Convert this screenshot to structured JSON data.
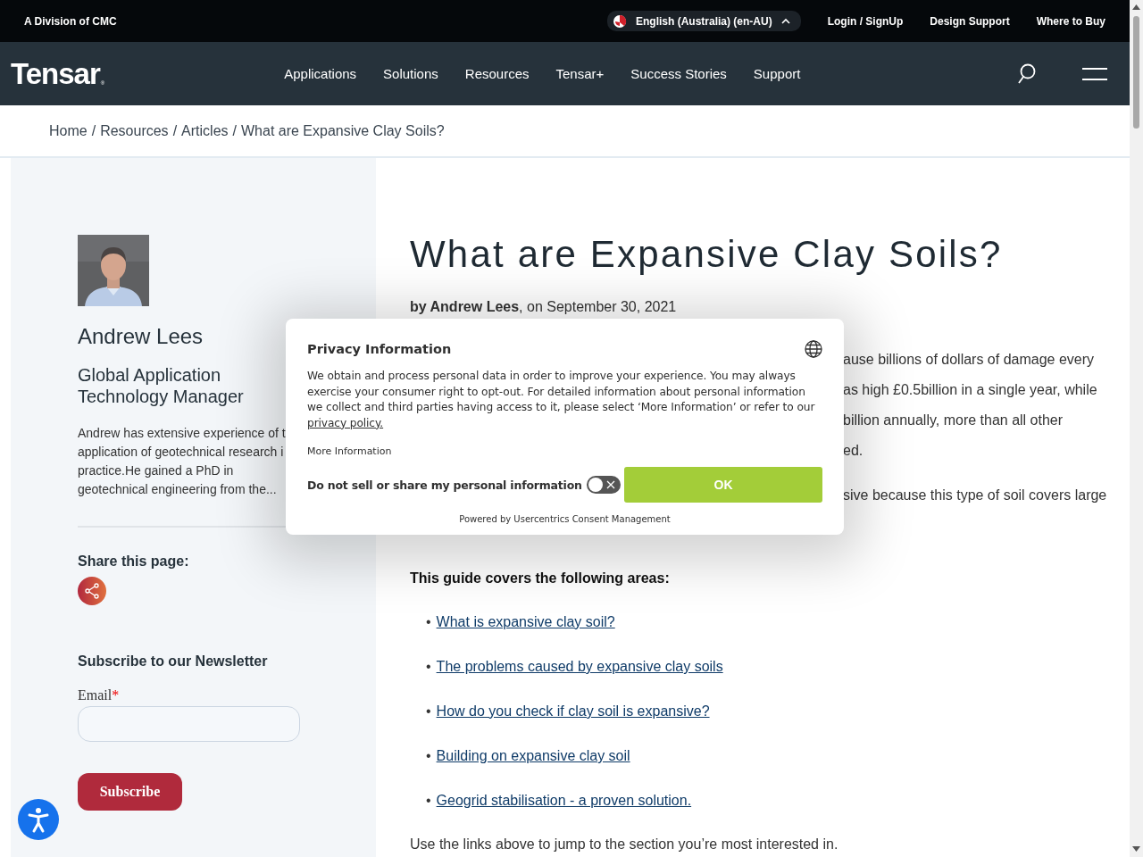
{
  "top_bar": {
    "division": "A Division of CMC",
    "language": "English (Australia) (en-AU)",
    "links": [
      "Login / SignUp",
      "Design Support",
      "Where to Buy"
    ]
  },
  "nav": {
    "logo": "Tensar",
    "logo_mark": "®",
    "items": [
      "Applications",
      "Solutions",
      "Resources",
      "Tensar+",
      "Success Stories",
      "Support"
    ]
  },
  "breadcrumb": {
    "items": [
      "Home",
      "Resources",
      "Articles",
      "What are Expansive Clay Soils?"
    ],
    "separators": [
      "/",
      "/",
      "/"
    ]
  },
  "author": {
    "photo": {
      "kind": "picture"
    },
    "name": "Andrew Lees",
    "role": "Global Application Technology Manager",
    "bio_lines": [
      "Andrew has extensive experience of t",
      "application of geotechnical research i",
      "practice.He gained a PhD in",
      "geotechnical engineering from the..."
    ],
    "share_heading": "Share this page:"
  },
  "newsletter": {
    "heading": "Subscribe to our Newsletter",
    "email_label": "Email",
    "required_mark": "*",
    "button": "Subscribe"
  },
  "article": {
    "title": "What are Expansive Clay Soils?",
    "byline": "**by Andrew Lees**, on September 30, 2021",
    "intro_fragments": [
      "ause billions of dollars of damage every",
      "as high £0.5billion in a single year, while",
      "billion annually, more than all other",
      "ed."
    ],
    "second_fragments": [
      "sive because this type of soil covers large"
    ],
    "guide_heading": "This guide covers the following areas:",
    "guide_links": [
      {
        "bullet": "•",
        "text": "What is expansive clay soil?"
      },
      {
        "bullet": "•",
        "text": "The problems caused by expansive clay soils"
      },
      {
        "bullet": "•",
        "text": "How do you check if clay soil is expansive?"
      },
      {
        "bullet": "•",
        "text": "Building on expansive clay soil"
      },
      {
        "bullet": "•",
        "text": "Geogrid stabilisation - a proven solution."
      }
    ],
    "closing": "Use the links above to jump to the section you’re most interested in."
  },
  "privacy_modal": {
    "title": "Privacy Information",
    "text": "We obtain and process personal data in order to improve your experience. You may always exercise your consumer right to opt-out. For detailed information about personal information we collect and third parties having access to it, please select ‘More Information’ or refer to our ",
    "policy_link": "privacy policy.",
    "more_info": "More Information",
    "toggle": {
      "label": "Do not sell or share my personal information",
      "on": false
    },
    "ok": "OK",
    "powered_by": "Powered by Usercentrics Consent Management"
  }
}
